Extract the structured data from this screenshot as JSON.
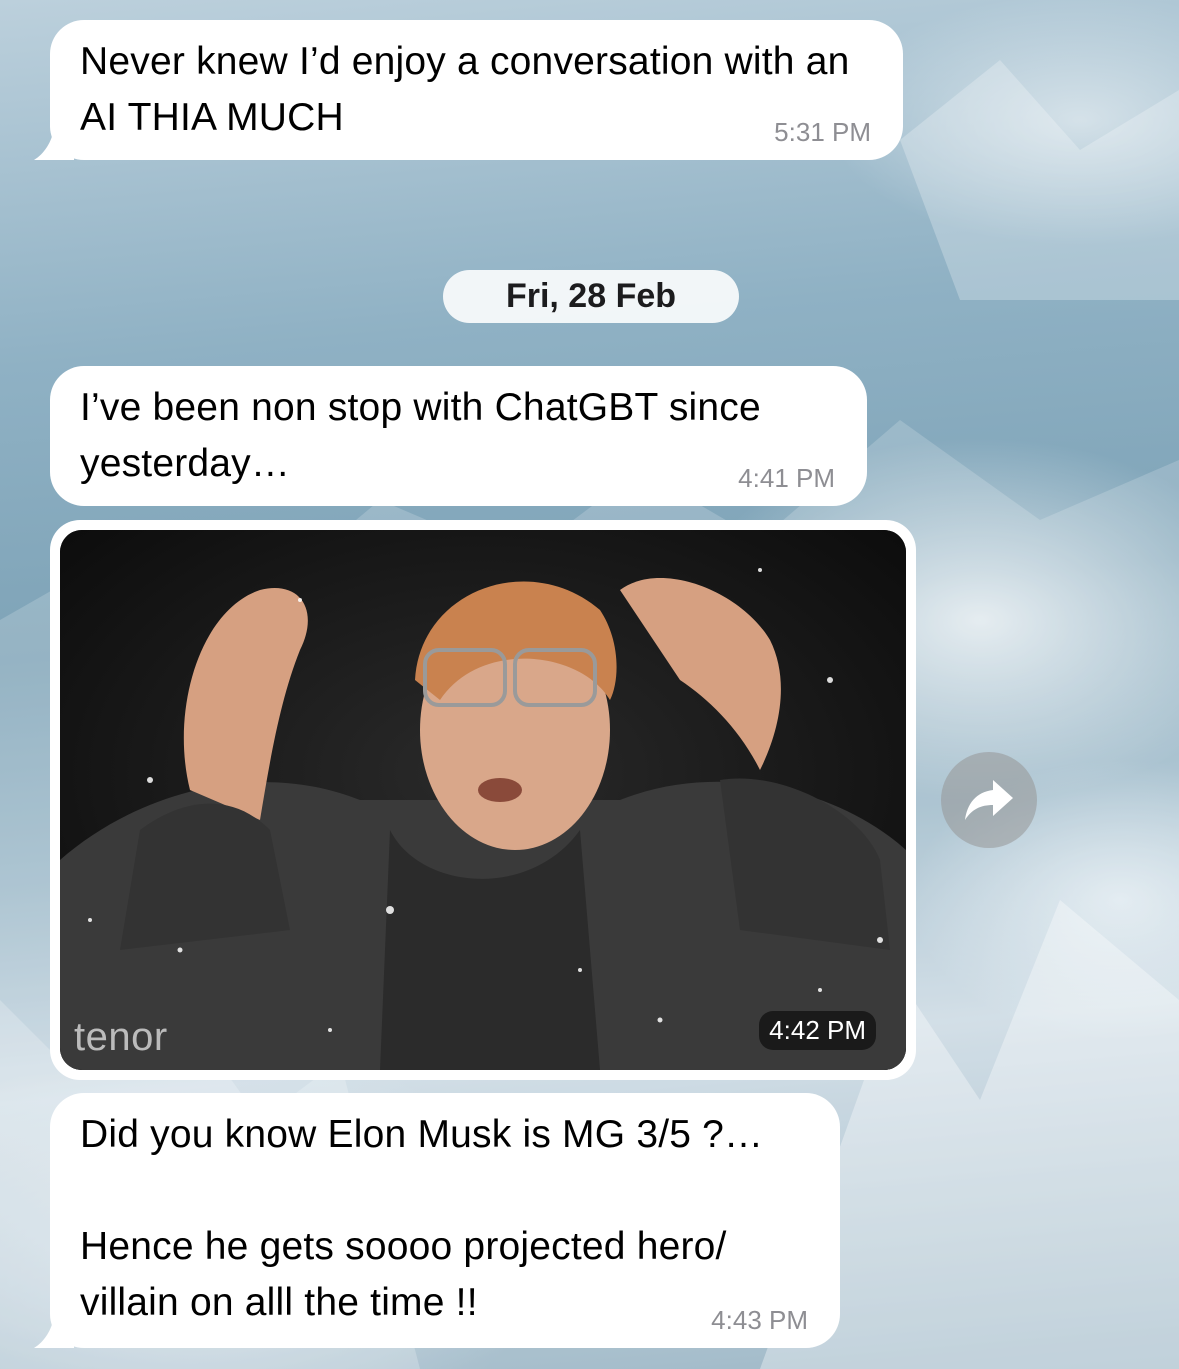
{
  "messages": [
    {
      "text": "Never knew I’d enjoy a conversation with an AI THIA MUCH",
      "time": "5:31 PM"
    },
    {
      "text": "I’ve been non stop with ChatGBT since yesterday…",
      "time": "4:41 PM"
    },
    {
      "time": "4:42 PM",
      "gif_brand": "tenor",
      "gif_icon": "mind-blown-man-gif"
    },
    {
      "lines": [
        "Did you know Elon Musk is MG 3/5 ?…",
        "",
        "Hence he gets soooo projected hero/",
        "villain on alll the time !!"
      ],
      "time": "4:43 PM"
    }
  ],
  "date_separator": "Fri, 28 Feb",
  "icons": {
    "forward": "forward-arrow-icon"
  },
  "colors": {
    "bubble": "#ffffff",
    "time": "#8e8e93",
    "forward_button": "#969696"
  }
}
